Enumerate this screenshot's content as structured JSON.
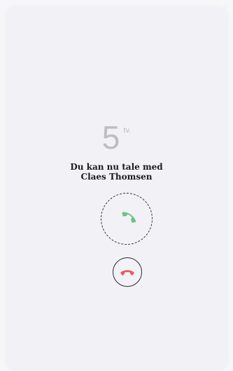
{
  "countdown": {
    "value": "5",
    "unit": "tv."
  },
  "message": {
    "line1": "Du kan nu tale med",
    "line2": "Claes Thomsen"
  },
  "icons": {
    "answer": "phone-answer-icon",
    "hangup": "phone-hangup-icon"
  },
  "colors": {
    "answer": "#6cc08a",
    "hangup": "#e85a64",
    "countdown": "#bdbdc3"
  }
}
